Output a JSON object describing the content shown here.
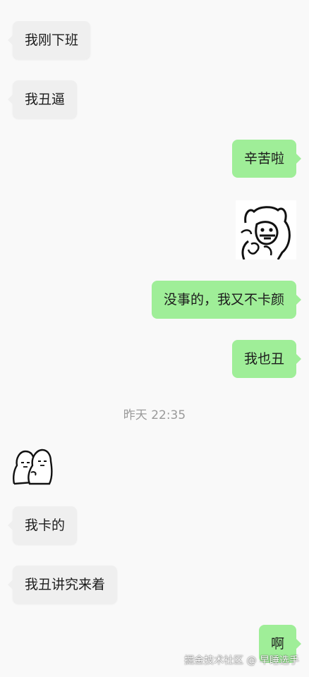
{
  "messages": [
    {
      "text": "我刚下班"
    },
    {
      "text": "我丑逼"
    },
    {
      "text": "辛苦啦"
    },
    {
      "sticker": "cat-drawing-sticker"
    },
    {
      "text": "没事的，我又不卡颜"
    },
    {
      "text": "我也丑"
    },
    {
      "sticker": "two-round-doodles-sticker"
    },
    {
      "text": "我卡的"
    },
    {
      "text": "我丑讲究来着"
    },
    {
      "text": "啊"
    }
  ],
  "timestamp": "昨天 22:35",
  "watermark": "掘金技术社区 @ 早睡选手",
  "colors": {
    "background": "#f9f9f9",
    "incoming_bubble": "#efefef",
    "outgoing_bubble": "#9fee98",
    "timestamp": "#9a9a9a"
  }
}
